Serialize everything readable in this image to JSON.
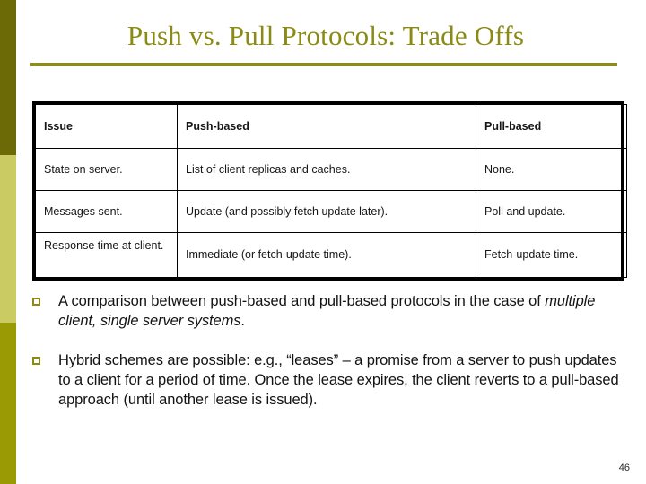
{
  "slide": {
    "title": "Push vs. Pull Protocols: Trade Offs",
    "page_number": "46"
  },
  "theme": {
    "accent_dark": "#6b6a07",
    "accent_light": "#cbcb63",
    "accent_mid": "#9a9a05",
    "title_color": "#8a8a14",
    "rule_color": "#8d8d1e",
    "body_text_color": "#131313",
    "table_border_color": "#000000"
  },
  "table": {
    "headers": [
      "Issue",
      "Push-based",
      "Pull-based"
    ],
    "rows": [
      {
        "issue": "State on server.",
        "push": "List of client replicas and caches.",
        "pull": "None."
      },
      {
        "issue": "Messages sent.",
        "push": "Update (and possibly fetch update later).",
        "pull": "Poll and update."
      },
      {
        "issue": "Response time at client.",
        "push": "Immediate (or fetch-update time).",
        "pull": "Fetch-update time."
      }
    ]
  },
  "bullets": [
    {
      "text_before": "A comparison between push-based and pull-based protocols in the case of ",
      "text_italic": "multiple client, single server systems",
      "text_after": "."
    },
    {
      "text_before": "Hybrid schemes are possible: e.g., “leases” – a promise from a server to push updates to a client for a period of time. Once the lease expires, the client reverts to a pull-based approach (until another lease is issued).",
      "text_italic": "",
      "text_after": ""
    }
  ]
}
